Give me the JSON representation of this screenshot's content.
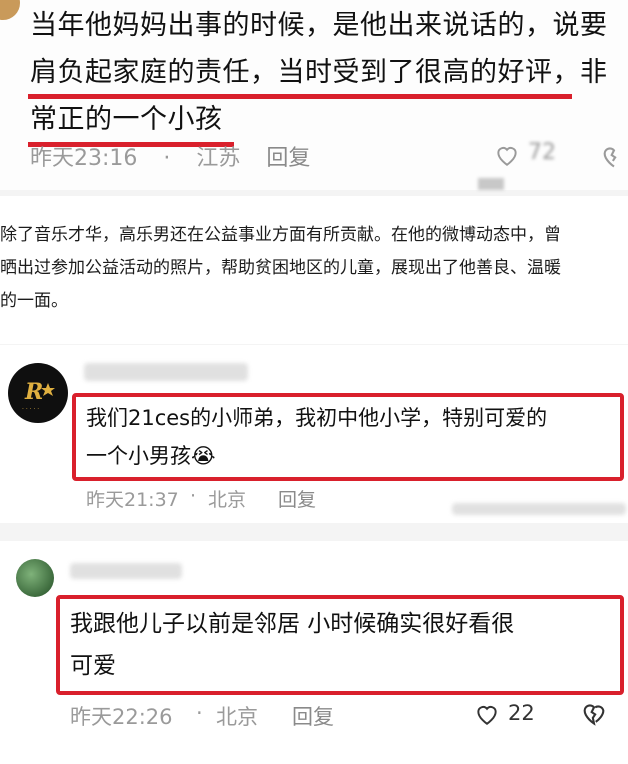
{
  "comment1": {
    "lines": [
      "当年他妈妈出事的时候，是他出来说话的，说要",
      "肩负起家庭的责任，当时受到了很高的好评，非",
      "常正的一个小孩"
    ],
    "time": "昨天23:16",
    "location": "江苏",
    "reply": "回复",
    "likes": "72"
  },
  "article": {
    "lines": [
      "除了音乐才华，高乐男还在公益事业方面有所贡献。在他的微博动态中，曾",
      "晒出过参加公益活动的照片，帮助贫困地区的儿童，展现出了他善良、温暖",
      "的一面。"
    ]
  },
  "comment2": {
    "lines": [
      "我们21ces的小师弟，我初中他小学，特别可爱的",
      "一个小男孩"
    ],
    "emoji": "😭",
    "time": "昨天21:37",
    "location": "北京",
    "reply": "回复",
    "dot": "·"
  },
  "comment3": {
    "lines": [
      "我跟他儿子以前是邻居 小时候确实很好看很",
      "可爱"
    ],
    "time": "昨天22:26",
    "location": "北京",
    "reply": "回复",
    "likes": "22",
    "dot": "·"
  },
  "icons": [
    "heart-icon",
    "broken-heart-icon"
  ],
  "accent_color": "#d9202c"
}
